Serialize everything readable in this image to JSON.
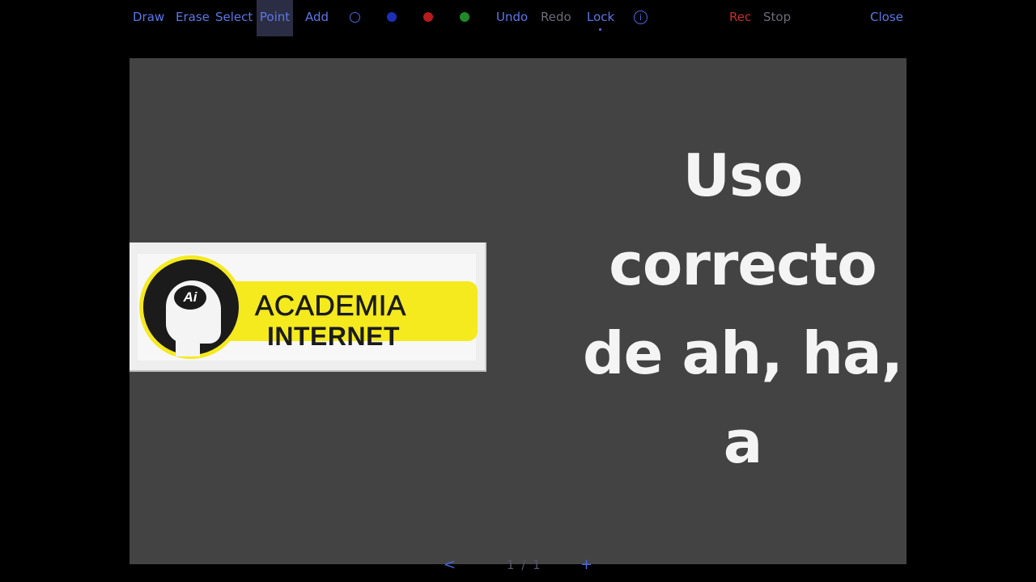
{
  "toolbar": {
    "draw": "Draw",
    "erase": "Erase",
    "select": "Select",
    "point": "Point",
    "add": "Add",
    "undo": "Undo",
    "redo": "Redo",
    "lock": "Lock",
    "info": "i",
    "rec": "Rec",
    "stop": "Stop",
    "close": "Close",
    "colors": {
      "outline": "#4a66e0",
      "blue": "#1d2fb8",
      "red": "#b51c1c",
      "green": "#1f8a2a"
    }
  },
  "slide": {
    "logo": {
      "badge": "Ai",
      "line1": "ACADEMIA",
      "line2": "INTERNET"
    },
    "title_lines": [
      "Uso",
      "correcto",
      "de ah, ha,",
      "a"
    ]
  },
  "pager": {
    "prev": "<",
    "count": "1 / 1",
    "add": "+"
  }
}
